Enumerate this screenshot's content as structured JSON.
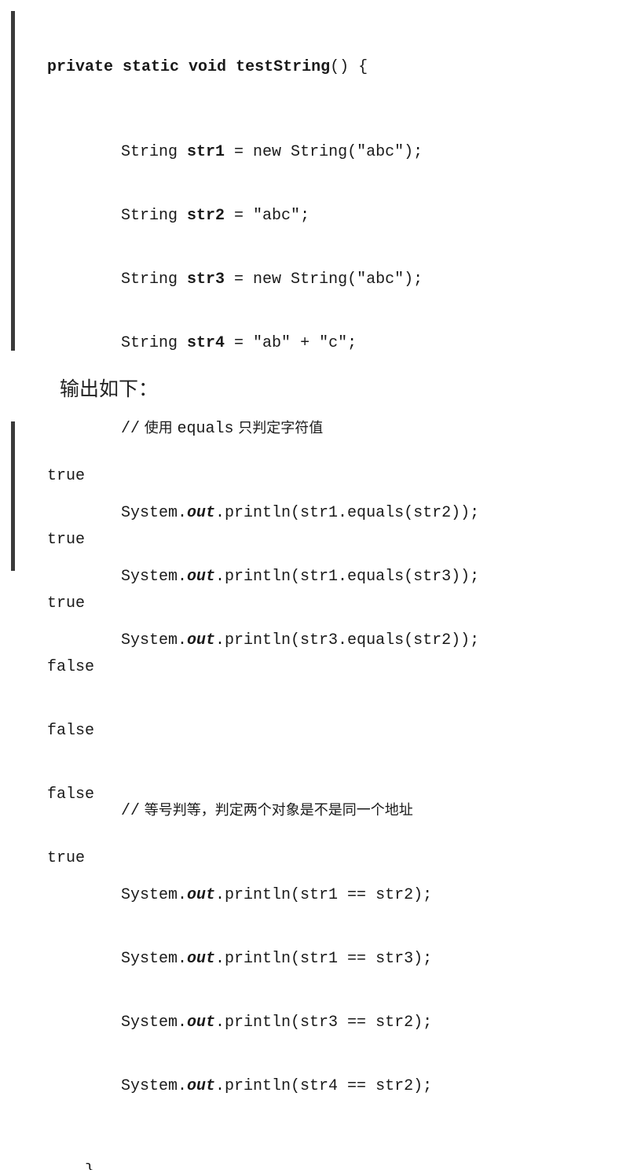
{
  "code": {
    "signature": {
      "kw": "private static void",
      "name": "testString",
      "rest": "() {"
    },
    "decls": [
      {
        "type": "String",
        "var": "str1",
        "init": " = new String(\"abc\");"
      },
      {
        "type": "String",
        "var": "str2",
        "init": " = \"abc\";"
      },
      {
        "type": "String",
        "var": "str3",
        "init": " = new String(\"abc\");"
      },
      {
        "type": "String",
        "var": "str4",
        "init": " = \"ab\" + \"c\";"
      }
    ],
    "comment1": {
      "slashes": "//",
      "pre": " 使用 ",
      "mono": "equals",
      "post": " 只判定字符值"
    },
    "equals_prints": [
      {
        "pre": "System.",
        "out": "out",
        "post": ".println(str1.equals(str2));"
      },
      {
        "pre": "System.",
        "out": "out",
        "post": ".println(str1.equals(str3));"
      },
      {
        "pre": "System.",
        "out": "out",
        "post": ".println(str3.equals(str2));"
      }
    ],
    "comment2": {
      "slashes": "//",
      "text": " 等号判等，判定两个对象是不是同一个地址"
    },
    "eq_prints": [
      {
        "pre": "System.",
        "out": "out",
        "post": ".println(str1 == str2);"
      },
      {
        "pre": "System.",
        "out": "out",
        "post": ".println(str1 == str3);"
      },
      {
        "pre": "System.",
        "out": "out",
        "post": ".println(str3 == str2);"
      },
      {
        "pre": "System.",
        "out": "out",
        "post": ".println(str4 == str2);"
      }
    ],
    "closing": "}"
  },
  "output_label": "输出如下：",
  "output_lines": [
    "true",
    "true",
    "true",
    "false",
    "false",
    "false",
    "true"
  ]
}
